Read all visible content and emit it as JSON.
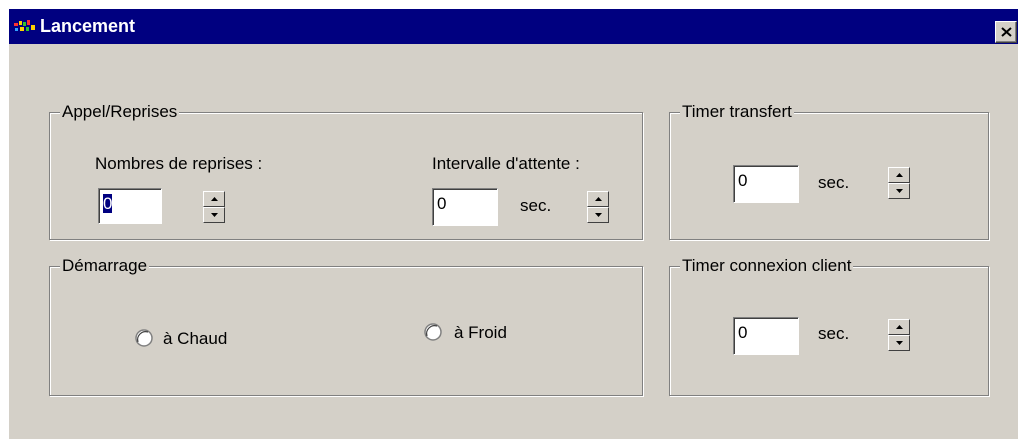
{
  "window": {
    "title": "Lancement",
    "app_icon": "app-icon",
    "close_icon": "close-icon"
  },
  "appel_reprises": {
    "legend": "Appel/Reprises",
    "nombres_label": "Nombres de reprises :",
    "nombres_value": "0",
    "intervalle_label": "Intervalle d'attente :",
    "intervalle_value": "0",
    "intervalle_unit": "sec."
  },
  "demarrage": {
    "legend": "Démarrage",
    "chaud_label": "à Chaud",
    "froid_label": "à Froid",
    "selected": "none"
  },
  "timer_transfert": {
    "legend": "Timer transfert",
    "value": "0",
    "unit": "sec."
  },
  "timer_connexion": {
    "legend": "Timer connexion client",
    "value": "0",
    "unit": "sec."
  },
  "colors": {
    "titlebar": "#000080",
    "face": "#d4d0c8"
  }
}
